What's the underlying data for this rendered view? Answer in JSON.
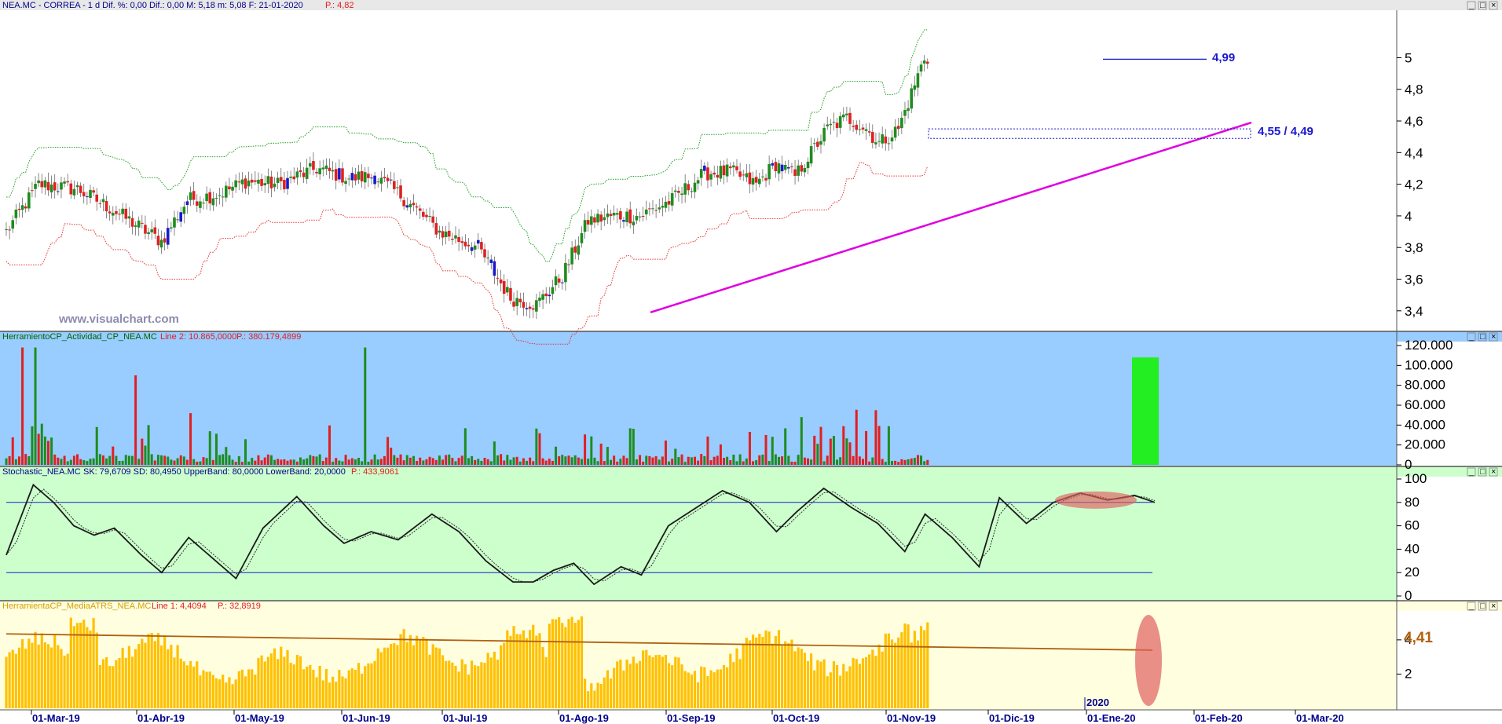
{
  "colors": {
    "up_candle": "#1e8c1e",
    "down_candle": "#e02020",
    "blue_candle": "#1a1acd",
    "upper_band": "#1e9e1e",
    "lower_band": "#e83030",
    "trendline": "#e000e0",
    "activity_bg": "#99ccff",
    "stoch_bg": "#ccffcc",
    "atr_bg": "#ffffe0",
    "atr_bar": "#ffc000",
    "atr_ma": "#b06010",
    "level_line": "#1a1acd",
    "highlight_green": "#22ee22",
    "highlight_red": "#e06060"
  },
  "header": {
    "title": "NEA.MC - CORREA -  1 d  Dif. %: 0,00  Dif.: 0,00  M: 5,18  m: 5,08  F: 21-01-2020",
    "p_value": "P.: 4,82"
  },
  "watermark": "www.visualchart.com",
  "annotations": {
    "resistance": "4,99",
    "support_zone": "4,55 / 4,49"
  },
  "activity_panel": {
    "title": "HerramientoCP_Actividad_CP_NEA.MC",
    "line": "Line 2: 10.865,0000",
    "p": "P.: 380.179,4899"
  },
  "stoch_panel": {
    "title": "Stochastic_NEA.MC",
    "values": "SK: 79,6709  SD: 80,4950  UpperBand: 80,0000  LowerBand: 20,0000",
    "p": "P.: 433,9061"
  },
  "atr_panel": {
    "title": "HerramientaCP_MediaATRS_NEA.MC",
    "line": "Line 1: 4,4094",
    "p": "P.: 32,8919",
    "last_value": "4,41"
  },
  "year_marker": "2020",
  "chart_data": [
    {
      "type": "candlestick",
      "name": "price",
      "x_labels": [
        "01-Mar-19",
        "01-Abr-19",
        "01-May-19",
        "01-Jun-19",
        "01-Jul-19",
        "01-Ago-19",
        "01-Sep-19",
        "01-Oct-19",
        "01-Nov-19",
        "01-Dic-19",
        "01-Ene-20",
        "01-Feb-20",
        "01-Mar-20"
      ],
      "y_ticks": [
        "5",
        "4,8",
        "4,6",
        "4,4",
        "4,2",
        "4",
        "3,8",
        "3,6",
        "3,4"
      ],
      "ylim": [
        3.27,
        5.3
      ],
      "close_key": [
        [
          0,
          3.9
        ],
        [
          10,
          4.2
        ],
        [
          22,
          4.17
        ],
        [
          32,
          4.05
        ],
        [
          42,
          3.92
        ],
        [
          48,
          3.84
        ],
        [
          56,
          4.1
        ],
        [
          66,
          4.14
        ],
        [
          74,
          4.22
        ],
        [
          84,
          4.2
        ],
        [
          96,
          4.3
        ],
        [
          106,
          4.24
        ],
        [
          114,
          4.25
        ],
        [
          122,
          4.13
        ],
        [
          134,
          3.9
        ],
        [
          146,
          3.8
        ],
        [
          156,
          3.48
        ],
        [
          164,
          3.44
        ],
        [
          172,
          3.62
        ],
        [
          180,
          3.97
        ],
        [
          188,
          4.0
        ],
        [
          196,
          4.0
        ],
        [
          206,
          4.1
        ],
        [
          216,
          4.27
        ],
        [
          224,
          4.28
        ],
        [
          232,
          4.2
        ],
        [
          238,
          4.33
        ],
        [
          244,
          4.25
        ],
        [
          248,
          4.37
        ],
        [
          254,
          4.55
        ],
        [
          260,
          4.62
        ],
        [
          266,
          4.55
        ],
        [
          270,
          4.46
        ],
        [
          276,
          4.55
        ],
        [
          284,
          5.0
        ]
      ],
      "levels": [
        {
          "label": "4,99",
          "value": 4.99
        },
        {
          "label": "4,55 / 4,49",
          "low": 4.49,
          "high": 4.55
        }
      ],
      "trendline": [
        [
          3.39,
          "01-Sep-19"
        ],
        [
          4.58,
          "after 01-Ene-20"
        ]
      ]
    },
    {
      "type": "bar",
      "name": "activity",
      "y_ticks": [
        "120.000",
        "100.000",
        "80.000",
        "60.000",
        "40.000",
        "20.000",
        "0"
      ],
      "ylim": [
        0,
        120000
      ]
    },
    {
      "type": "line",
      "name": "stochastic",
      "y_ticks": [
        "100",
        "80",
        "60",
        "40",
        "20",
        "0"
      ],
      "ylim": [
        0,
        100
      ],
      "bands": [
        80,
        20
      ],
      "sk_key": [
        [
          0,
          35
        ],
        [
          8,
          95
        ],
        [
          14,
          80
        ],
        [
          20,
          60
        ],
        [
          26,
          52
        ],
        [
          32,
          58
        ],
        [
          40,
          35
        ],
        [
          46,
          20
        ],
        [
          54,
          50
        ],
        [
          60,
          35
        ],
        [
          68,
          15
        ],
        [
          76,
          58
        ],
        [
          86,
          85
        ],
        [
          94,
          60
        ],
        [
          100,
          45
        ],
        [
          108,
          55
        ],
        [
          116,
          48
        ],
        [
          126,
          70
        ],
        [
          134,
          55
        ],
        [
          142,
          30
        ],
        [
          150,
          12
        ],
        [
          156,
          12
        ],
        [
          162,
          22
        ],
        [
          168,
          28
        ],
        [
          174,
          10
        ],
        [
          182,
          25
        ],
        [
          188,
          18
        ],
        [
          196,
          60
        ],
        [
          204,
          75
        ],
        [
          212,
          90
        ],
        [
          220,
          80
        ],
        [
          228,
          55
        ],
        [
          234,
          72
        ],
        [
          242,
          92
        ],
        [
          250,
          76
        ],
        [
          258,
          62
        ],
        [
          266,
          38
        ],
        [
          272,
          70
        ],
        [
          280,
          50
        ],
        [
          288,
          25
        ],
        [
          294,
          84
        ],
        [
          302,
          62
        ],
        [
          310,
          80
        ],
        [
          318,
          88
        ],
        [
          326,
          82
        ],
        [
          334,
          86
        ],
        [
          340,
          80
        ]
      ]
    },
    {
      "type": "bar",
      "name": "atr",
      "y_ticks": [
        "4",
        "2"
      ],
      "ylim": [
        0,
        5.6
      ],
      "ma_start": 4.35,
      "ma_end": 3.4
    }
  ]
}
